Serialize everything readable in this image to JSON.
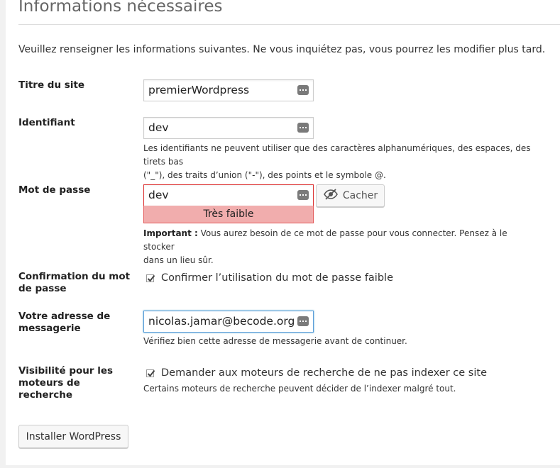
{
  "heading": "Informations nécessaires",
  "intro": "Veuillez renseigner les informations suivantes. Ne vous inquiétez pas, vous pourrez les modifier plus tard.",
  "site_title": {
    "label": "Titre du site",
    "value": "premierWordpress"
  },
  "username": {
    "label": "Identifiant",
    "value": "dev",
    "help_line1": "Les identifiants ne peuvent utiliser que des caractères alphanumériques, des espaces, des tirets bas",
    "help_line2": "(\"_\"), des traits d’union (\"-\"), des points et le symbole @."
  },
  "password": {
    "label": "Mot de passe",
    "value": "dev",
    "strength": "Très faible",
    "hide_button": "Cacher",
    "important_label": "Important :",
    "important_line1": " Vous aurez besoin de ce mot de passe pour vous connecter. Pensez à le stocker",
    "important_line2": "dans un lieu sûr."
  },
  "confirm_weak": {
    "label_line1": "Confirmation du mot",
    "label_line2": "de passe",
    "checkbox_label": "Confirmer l’utilisation du mot de passe faible",
    "checked": true
  },
  "email": {
    "label_line1": "Votre adresse de",
    "label_line2": "messagerie",
    "value": "nicolas.jamar@becode.org",
    "help": "Vérifiez bien cette adresse de messagerie avant de continuer."
  },
  "visibility": {
    "label_line1": "Visibilité pour les",
    "label_line2": "moteurs de",
    "label_line3": "recherche",
    "checkbox_label": "Demander aux moteurs de recherche de ne pas indexer ce site",
    "checked": true,
    "help": "Certains moteurs de recherche peuvent décider de l’indexer malgré tout."
  },
  "install_button": "Installer WordPress",
  "colors": {
    "weak_bg": "#f1adad",
    "weak_border": "#dc3232",
    "focus_border": "#5b9dd9"
  },
  "icons": [
    "password-manager-dots-icon",
    "eye-slash-icon",
    "checkmark-icon"
  ]
}
